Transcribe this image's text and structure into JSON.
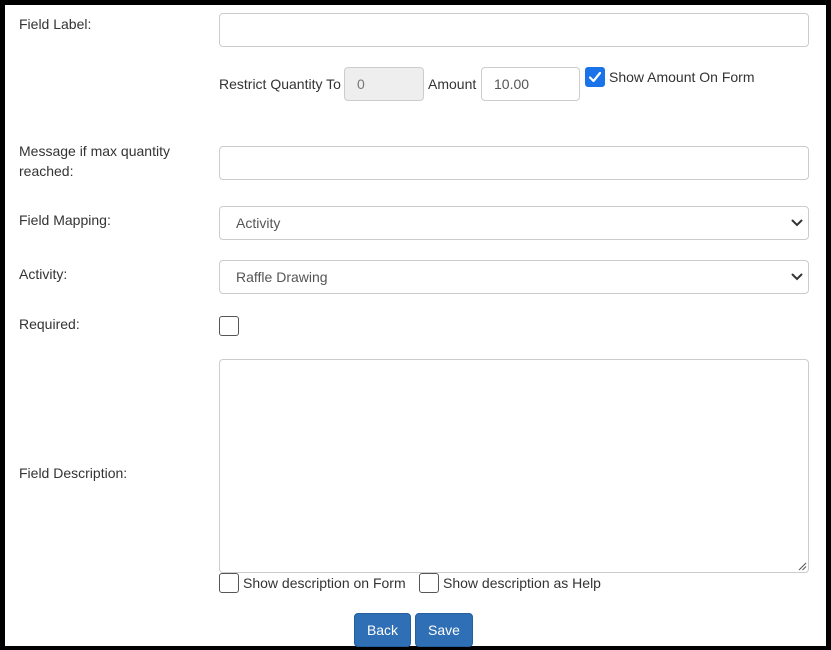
{
  "form": {
    "field_label": {
      "label": "Field Label:",
      "value": ""
    },
    "restrict": {
      "label": "Restrict Quantity To",
      "value": "0",
      "amount_label": "Amount",
      "amount_value": "10.00",
      "show_amount_label": "Show Amount On Form",
      "show_amount_checked": true
    },
    "max_message": {
      "label_line1": "Message if max quantity",
      "label_line2": "reached:",
      "value": ""
    },
    "field_mapping": {
      "label": "Field Mapping:",
      "selected": "Activity"
    },
    "activity": {
      "label": "Activity:",
      "selected": "Raffle Drawing"
    },
    "required": {
      "label": "Required:",
      "checked": false
    },
    "description": {
      "label": "Field Description:",
      "value": "",
      "show_on_form_label": "Show description on Form",
      "show_on_form_checked": false,
      "show_as_help_label": "Show description as Help",
      "show_as_help_checked": false
    }
  },
  "buttons": {
    "back": "Back",
    "save": "Save"
  },
  "colors": {
    "primary_button": "#2f6fb5",
    "checkbox_checked": "#1a73e8"
  }
}
